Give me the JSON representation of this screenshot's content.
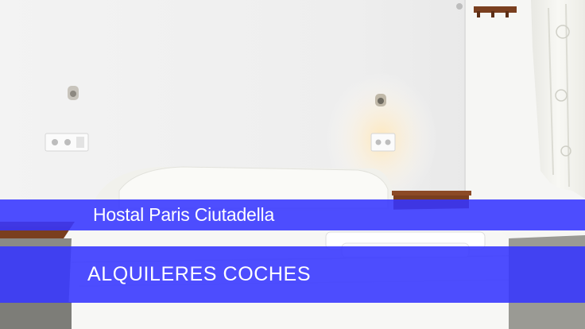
{
  "photo": {
    "subject": "hotel-room-bed",
    "colors": {
      "wall": "#f2f2f2",
      "bedspread": "#f7f7f5",
      "wood": "#7a3f1f",
      "floor": "#8a8a85",
      "lamp_glow": "#ffe7b8"
    }
  },
  "banners": {
    "title": "Hostal Paris Ciutadella",
    "subtitle": "ALQUILERES COCHES",
    "color": "#3636ff"
  }
}
